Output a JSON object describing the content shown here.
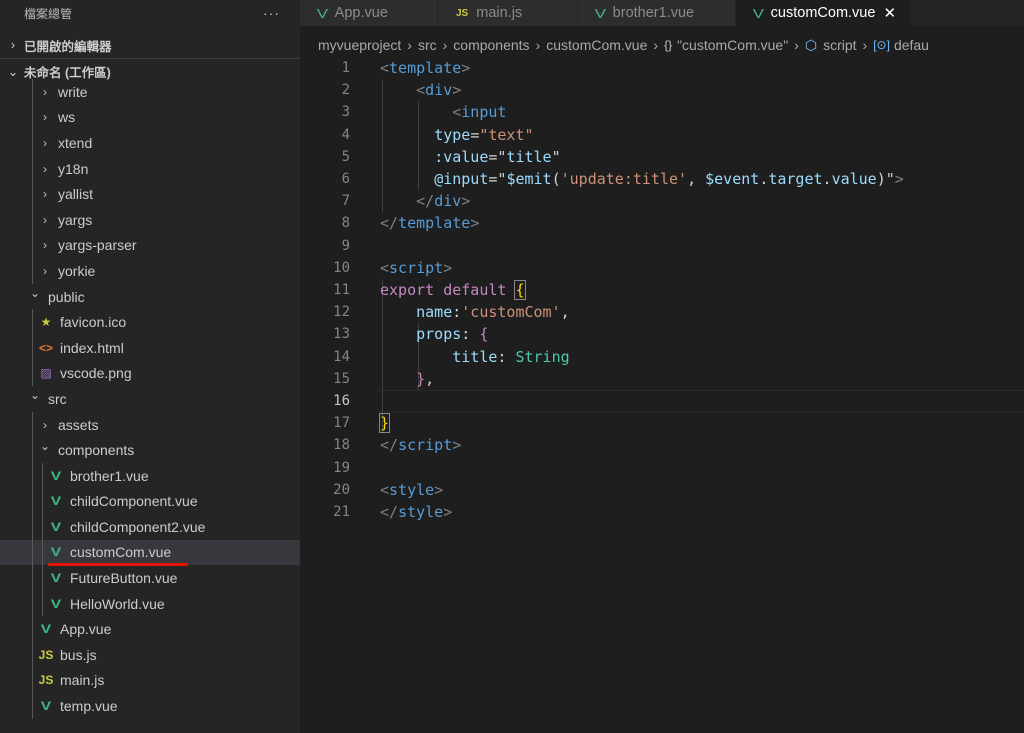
{
  "sidebar": {
    "title": "檔案總管",
    "more_label": "···",
    "open_editors_label": "已開啟的編輯器",
    "workspace_label": "未命名 (工作區)",
    "items": [
      {
        "label": "write",
        "kind": "folder",
        "depth": 2,
        "expanded": false
      },
      {
        "label": "ws",
        "kind": "folder",
        "depth": 2,
        "expanded": false
      },
      {
        "label": "xtend",
        "kind": "folder",
        "depth": 2,
        "expanded": false
      },
      {
        "label": "y18n",
        "kind": "folder",
        "depth": 2,
        "expanded": false
      },
      {
        "label": "yallist",
        "kind": "folder",
        "depth": 2,
        "expanded": false
      },
      {
        "label": "yargs",
        "kind": "folder",
        "depth": 2,
        "expanded": false
      },
      {
        "label": "yargs-parser",
        "kind": "folder",
        "depth": 2,
        "expanded": false
      },
      {
        "label": "yorkie",
        "kind": "folder",
        "depth": 2,
        "expanded": false
      },
      {
        "label": "public",
        "kind": "folder",
        "depth": 1,
        "expanded": true
      },
      {
        "label": "favicon.ico",
        "kind": "ico",
        "depth": 2
      },
      {
        "label": "index.html",
        "kind": "html",
        "depth": 2
      },
      {
        "label": "vscode.png",
        "kind": "png",
        "depth": 2
      },
      {
        "label": "src",
        "kind": "folder",
        "depth": 1,
        "expanded": true
      },
      {
        "label": "assets",
        "kind": "folder",
        "depth": 2,
        "expanded": false
      },
      {
        "label": "components",
        "kind": "folder",
        "depth": 2,
        "expanded": true
      },
      {
        "label": "brother1.vue",
        "kind": "vue",
        "depth": 3
      },
      {
        "label": "childComponent.vue",
        "kind": "vue",
        "depth": 3
      },
      {
        "label": "childComponent2.vue",
        "kind": "vue",
        "depth": 3
      },
      {
        "label": "customCom.vue",
        "kind": "vue",
        "depth": 3,
        "selected": true
      },
      {
        "label": "FutureButton.vue",
        "kind": "vue",
        "depth": 3
      },
      {
        "label": "HelloWorld.vue",
        "kind": "vue",
        "depth": 3
      },
      {
        "label": "App.vue",
        "kind": "vue",
        "depth": 2
      },
      {
        "label": "bus.js",
        "kind": "js",
        "depth": 2
      },
      {
        "label": "main.js",
        "kind": "js",
        "depth": 2
      },
      {
        "label": "temp.vue",
        "kind": "vue",
        "depth": 2
      }
    ]
  },
  "tabs": [
    {
      "label": "App.vue",
      "icon": "vue-icon",
      "width": 138
    },
    {
      "label": "main.js",
      "icon": "js-icon",
      "width": 140
    },
    {
      "label": "brother1.vue",
      "icon": "vue-icon",
      "width": 158
    },
    {
      "label": "customCom.vue",
      "icon": "vue-icon",
      "active": true,
      "close": "✕",
      "width": 176
    }
  ],
  "breadcrumb": [
    "myvueproject",
    "src",
    "components",
    "customCom.vue",
    "\"customCom.vue\"",
    "script",
    "defau"
  ],
  "editor": {
    "active_line": 16,
    "lines": [
      {
        "n": "1",
        "tokens": [
          [
            "t-punc",
            "<"
          ],
          [
            "t-tag",
            "template"
          ],
          [
            "t-punc",
            ">"
          ]
        ]
      },
      {
        "n": "2",
        "tokens": [
          [
            "t-plain",
            "    "
          ],
          [
            "t-punc",
            "<"
          ],
          [
            "t-tag",
            "div"
          ],
          [
            "t-punc",
            ">"
          ]
        ]
      },
      {
        "n": "3",
        "tokens": [
          [
            "t-plain",
            "        "
          ],
          [
            "t-punc",
            "<"
          ],
          [
            "t-tag",
            "input"
          ]
        ]
      },
      {
        "n": "4",
        "tokens": [
          [
            "t-plain",
            "      "
          ],
          [
            "t-attr",
            "type"
          ],
          [
            "t-plain",
            "="
          ],
          [
            "t-str",
            "\"text\""
          ]
        ]
      },
      {
        "n": "5",
        "tokens": [
          [
            "t-plain",
            "      "
          ],
          [
            "t-attr",
            ":value"
          ],
          [
            "t-plain",
            "="
          ],
          [
            "t-plain",
            "\""
          ],
          [
            "t-attr",
            "title"
          ],
          [
            "t-plain",
            "\""
          ]
        ]
      },
      {
        "n": "6",
        "tokens": [
          [
            "t-plain",
            "      "
          ],
          [
            "t-attr",
            "@input"
          ],
          [
            "t-plain",
            "="
          ],
          [
            "t-plain",
            "\""
          ],
          [
            "t-attr",
            "$emit"
          ],
          [
            "t-plain",
            "("
          ],
          [
            "t-str",
            "'update:title'"
          ],
          [
            "t-plain",
            ", "
          ],
          [
            "t-attr",
            "$event"
          ],
          [
            "t-plain",
            "."
          ],
          [
            "t-attr",
            "target"
          ],
          [
            "t-plain",
            "."
          ],
          [
            "t-attr",
            "value"
          ],
          [
            "t-plain",
            ")\""
          ],
          [
            "t-punc",
            ">"
          ]
        ]
      },
      {
        "n": "7",
        "tokens": [
          [
            "t-plain",
            "    "
          ],
          [
            "t-punc",
            "</"
          ],
          [
            "t-tag",
            "div"
          ],
          [
            "t-punc",
            ">"
          ]
        ]
      },
      {
        "n": "8",
        "tokens": [
          [
            "t-punc",
            "</"
          ],
          [
            "t-tag",
            "template"
          ],
          [
            "t-punc",
            ">"
          ]
        ]
      },
      {
        "n": "9",
        "tokens": []
      },
      {
        "n": "10",
        "tokens": [
          [
            "t-punc",
            "<"
          ],
          [
            "t-tag",
            "script"
          ],
          [
            "t-punc",
            ">"
          ]
        ]
      },
      {
        "n": "11",
        "tokens": [
          [
            "t-kw",
            "export"
          ],
          [
            "t-plain",
            " "
          ],
          [
            "t-kw",
            "default"
          ],
          [
            "t-plain",
            " "
          ],
          [
            "t-yellow",
            "{"
          ]
        ]
      },
      {
        "n": "12",
        "tokens": [
          [
            "t-plain",
            "    "
          ],
          [
            "t-attr",
            "name"
          ],
          [
            "t-plain",
            ":"
          ],
          [
            "t-str",
            "'customCom'"
          ],
          [
            "t-plain",
            ","
          ]
        ]
      },
      {
        "n": "13",
        "tokens": [
          [
            "t-plain",
            "    "
          ],
          [
            "t-attr",
            "props"
          ],
          [
            "t-plain",
            ": "
          ],
          [
            "t-kw",
            "{"
          ]
        ]
      },
      {
        "n": "14",
        "tokens": [
          [
            "t-plain",
            "        "
          ],
          [
            "t-attr",
            "title"
          ],
          [
            "t-plain",
            ": "
          ],
          [
            "t-type",
            "String"
          ]
        ]
      },
      {
        "n": "15",
        "tokens": [
          [
            "t-plain",
            "    "
          ],
          [
            "t-kw",
            "}"
          ],
          [
            "t-plain",
            ","
          ]
        ]
      },
      {
        "n": "16",
        "tokens": []
      },
      {
        "n": "17",
        "tokens": [
          [
            "t-yellow",
            "}"
          ]
        ]
      },
      {
        "n": "18",
        "tokens": [
          [
            "t-punc",
            "</"
          ],
          [
            "t-tag",
            "script"
          ],
          [
            "t-punc",
            ">"
          ]
        ]
      },
      {
        "n": "19",
        "tokens": []
      },
      {
        "n": "20",
        "tokens": [
          [
            "t-punc",
            "<"
          ],
          [
            "t-tag",
            "style"
          ],
          [
            "t-punc",
            ">"
          ]
        ]
      },
      {
        "n": "21",
        "tokens": [
          [
            "t-punc",
            "</"
          ],
          [
            "t-tag",
            "style"
          ],
          [
            "t-punc",
            ">"
          ]
        ]
      }
    ]
  }
}
